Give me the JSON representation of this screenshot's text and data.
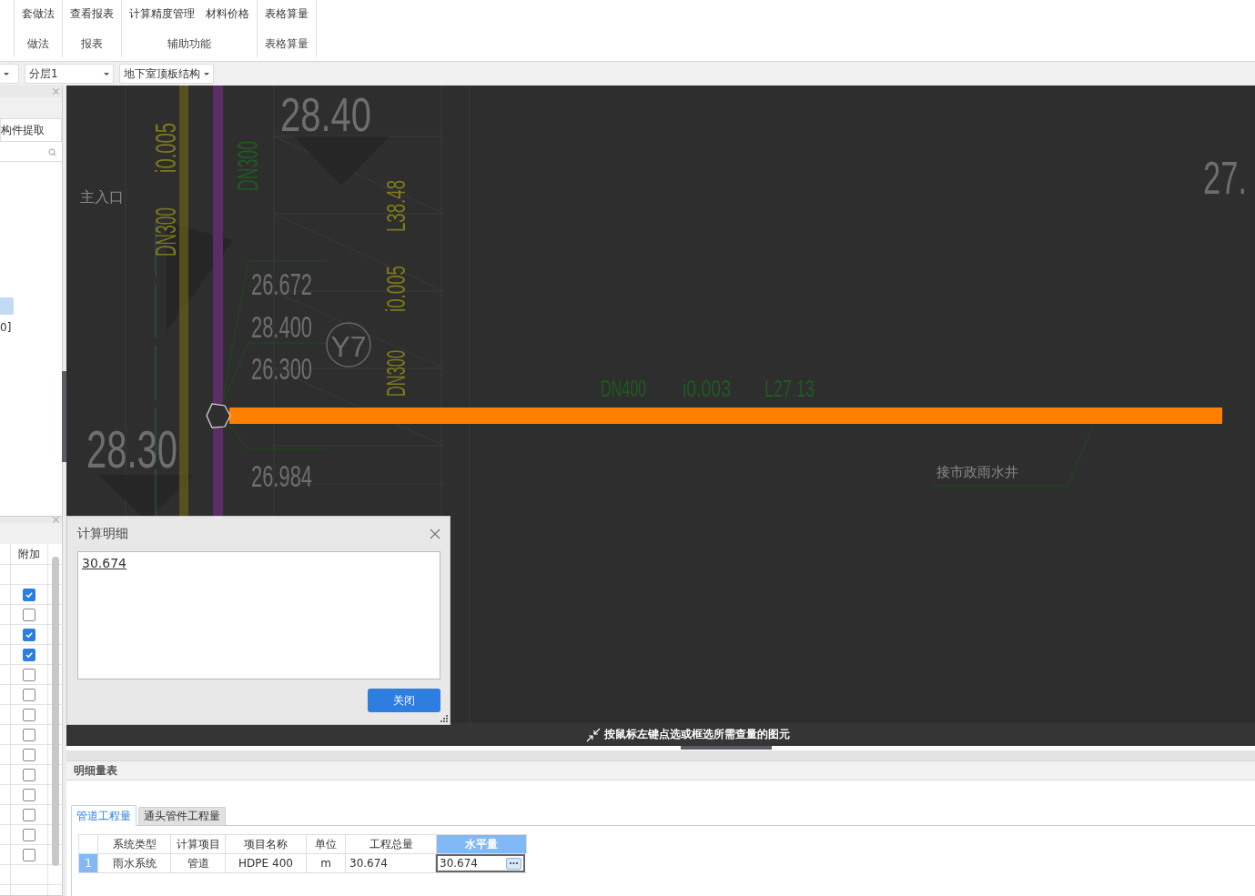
{
  "ribbon": {
    "groups": [
      {
        "label": "做法",
        "items": [
          {
            "label": "套做法"
          }
        ]
      },
      {
        "label": "报表",
        "items": [
          {
            "label": "查看报表"
          }
        ]
      },
      {
        "label": "辅助功能",
        "items": [
          {
            "label": "计算精度管理"
          },
          {
            "label": "材料价格"
          }
        ]
      },
      {
        "label": "表格算量",
        "items": [
          {
            "label": "表格算量"
          }
        ]
      }
    ]
  },
  "toolbar": {
    "dropdowns": [
      {
        "value": "分层1"
      },
      {
        "value": "地下室顶板结构"
      }
    ]
  },
  "left_panel": {
    "tab": "构件提取",
    "items": [
      {
        "selected": true
      },
      {
        "label": "0]",
        "selected": false
      }
    ],
    "table": {
      "column": "附加",
      "rows": [
        {
          "checked": true
        },
        {
          "checked": false
        },
        {
          "checked": true
        },
        {
          "checked": true
        },
        {
          "checked": false
        },
        {
          "checked": false
        },
        {
          "checked": false
        },
        {
          "checked": false
        },
        {
          "checked": false
        },
        {
          "checked": false
        },
        {
          "checked": false
        },
        {
          "checked": false
        },
        {
          "checked": false
        },
        {
          "checked": false
        }
      ]
    }
  },
  "canvas": {
    "labels": [
      {
        "text": "28.40",
        "kind": "elevation"
      },
      {
        "text": "i0.005",
        "kind": "annotation"
      },
      {
        "text": "DN300",
        "kind": "annotation"
      },
      {
        "text": "DN300",
        "kind": "pipe_label"
      },
      {
        "text": "L38.48",
        "kind": "annotation"
      },
      {
        "text": "i0.005",
        "kind": "annotation"
      },
      {
        "text": "DN300",
        "kind": "annotation"
      },
      {
        "text": "26.672",
        "kind": "elevation"
      },
      {
        "text": "28.400",
        "kind": "elevation"
      },
      {
        "text": "26.300",
        "kind": "elevation"
      },
      {
        "text": "Y7",
        "kind": "elevation"
      },
      {
        "text": "28.30",
        "kind": "elevation"
      },
      {
        "text": "26.984",
        "kind": "elevation"
      },
      {
        "text": "主入口",
        "kind": "note"
      },
      {
        "text": "27.",
        "kind": "elevation"
      },
      {
        "text": "DN400",
        "kind": "pipe_label"
      },
      {
        "text": "i0.003",
        "kind": "pipe_label"
      },
      {
        "text": "L27.13",
        "kind": "pipe_label"
      },
      {
        "text": "接市政雨水井",
        "kind": "note"
      }
    ],
    "status_hint": "按鼠标左键点选或框选所需查量的图元"
  },
  "dialog": {
    "title": "计算明细",
    "content": "30.674",
    "button": "关闭"
  },
  "detail_panel": {
    "title": "明细量表",
    "tabs": [
      {
        "label": "管道工程量",
        "selected": true
      },
      {
        "label": "通头管件工程量",
        "selected": false
      }
    ],
    "table": {
      "columns": [
        {
          "label": "系统类型",
          "selected": false
        },
        {
          "label": "计算项目",
          "selected": false
        },
        {
          "label": "项目名称",
          "selected": false
        },
        {
          "label": "单位",
          "selected": false
        },
        {
          "label": "工程总量",
          "selected": false
        },
        {
          "label": "水平量",
          "selected": true
        }
      ],
      "rows": [
        {
          "number": "1",
          "selected": true,
          "cells": [
            "雨水系统",
            "管道",
            "HDPE 400",
            "m",
            "30.674",
            "30.674"
          ]
        }
      ]
    }
  }
}
